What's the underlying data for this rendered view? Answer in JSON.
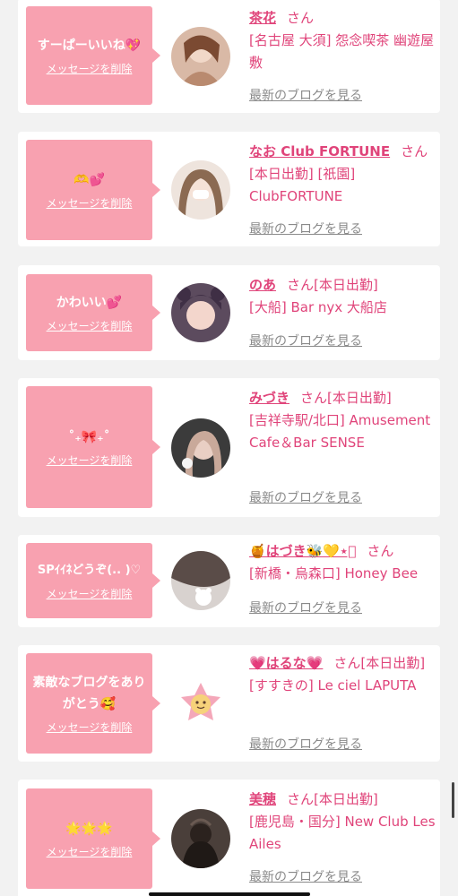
{
  "delete_label": "メッセージを削除",
  "blog_label": "最新のブログを見る",
  "san_label": "さん",
  "accent_color": "#e0447a",
  "bubble_color": "#f8a1b0",
  "entries": [
    {
      "message": "すーぱーいいね💖",
      "name": "茶花",
      "san": "さん",
      "shop": "[名古屋 大須] 怨念喫茶 幽遊屋敷"
    },
    {
      "message": "🫶💕",
      "name": "なお Club FORTUNE",
      "san": "さん",
      "shop": "[本日出勤] [祇園] ClubFORTUNE"
    },
    {
      "message": "かわいい💕",
      "name": "のあ",
      "san": "さん[本日出勤]",
      "shop": "[大船] Bar nyx 大船店"
    },
    {
      "message": "˚₊🎀₊˚",
      "name": "みづき",
      "san": "さん[本日出勤]",
      "shop": "[吉祥寺駅/北口] Amusement Cafe＆Bar SENSE"
    },
    {
      "message": "SPｲｲﾈどうぞ(.. )♡",
      "name": "🍯はづき🐝💛⋆͛",
      "san": "さん",
      "shop": "[新橋・烏森口] Honey Bee"
    },
    {
      "message": "素敵なブログをありがとう🥰",
      "name": "💗はるな💗",
      "san": "さん[本日出勤]",
      "shop": "[すすきの] Le ciel LAPUTA"
    },
    {
      "message": "🌟🌟🌟",
      "name": "美穂",
      "san": "さん[本日出勤]",
      "shop": "[鹿児島・国分] New Club Les Ailes"
    }
  ]
}
